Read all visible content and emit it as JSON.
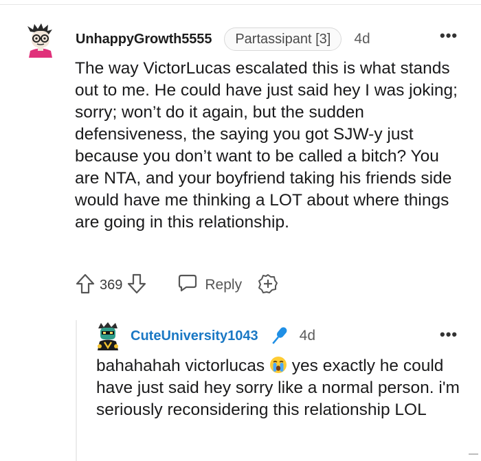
{
  "comment": {
    "username": "UnhappyGrowth5555",
    "flair": "Partassipant [3]",
    "time": "4d",
    "more": "•••",
    "body": "The way VictorLucas escalated this is what stands out to me. He could have just said hey I was joking; sorry; won’t do it again, but the sudden defensiveness, the saying you got SJW-y just because you don’t want to be called a bitch? You are NTA, and your boyfriend taking his friends side would have me thinking a LOT about where things are going in this relationship.",
    "score": "369",
    "reply_label": "Reply",
    "icons": [
      "upvote-icon",
      "downvote-icon",
      "reply-icon",
      "award-icon",
      "more-icon"
    ]
  },
  "reply": {
    "username": "CuteUniversity1043",
    "time": "4d",
    "more": "•••",
    "body_before": "bahahahah victorlucas ",
    "body_after": " yes exactly he could have just said hey sorry like a normal person. i'm seriously reconsidering this relationship LOL",
    "icons": [
      "microphone-icon",
      "crying-face-emoji",
      "more-icon"
    ]
  },
  "colors": {
    "text": "#1a1a1b",
    "reply_username": "#1a78c4",
    "mic": "#1f8fe5",
    "meta": "#5c5c5c",
    "border": "#d9d9d9"
  }
}
